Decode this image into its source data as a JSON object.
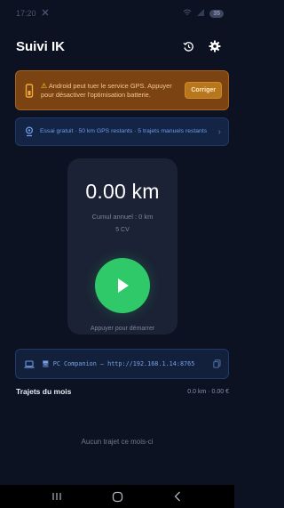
{
  "status_bar": {
    "time": "17:20",
    "battery": "35"
  },
  "app": {
    "title": "Suivi IK"
  },
  "warning": {
    "icon_name": "warning-triangle-icon",
    "message": "Android peut tuer le service GPS. Appuyer pour désactiver l'optimisation batterie.",
    "button_label": "Corriger",
    "accent_color": "#b8761d"
  },
  "trial": {
    "message": "Essai gratuit · 50 km GPS restants · 5 trajets manuels restants"
  },
  "tracker": {
    "distance": "0.00 km",
    "annual_total": "Cumul annuel : 0 km",
    "fiscal_power": "5 CV",
    "start_hint": "Appuyer pour démarrer",
    "play_color": "#2fc96a"
  },
  "companion": {
    "text": "PC Companion — http://192.168.1.14:8765"
  },
  "month": {
    "title": "Trajets du mois",
    "summary": "0.0 km · 0.00 €",
    "empty_message": "Aucun trajet ce mois-ci"
  }
}
